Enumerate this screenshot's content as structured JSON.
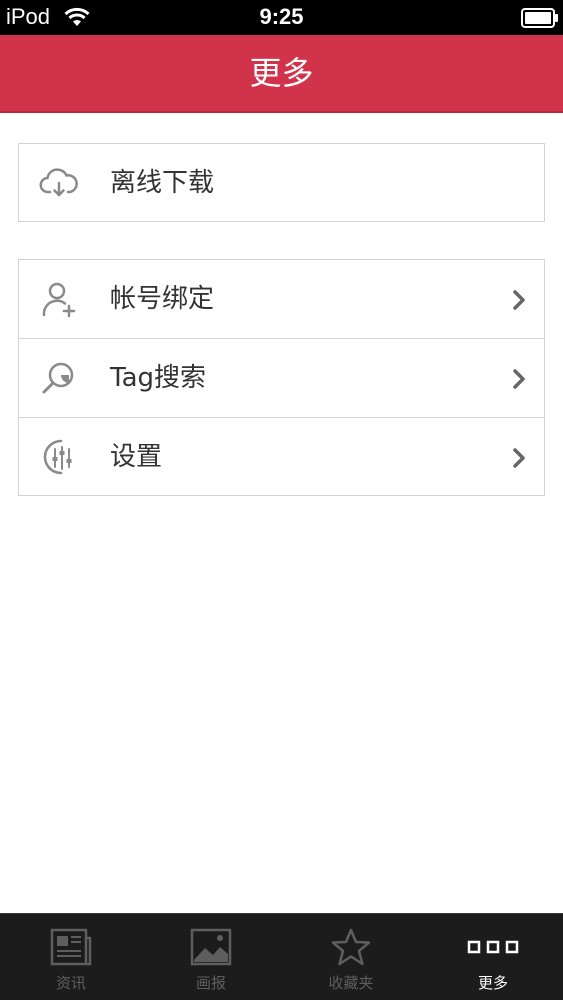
{
  "status_bar": {
    "carrier": "iPod",
    "time": "9:25"
  },
  "nav": {
    "title": "更多"
  },
  "groups": [
    {
      "items": [
        {
          "label": "离线下载",
          "icon": "cloud-download-icon",
          "has_chevron": false
        }
      ]
    },
    {
      "items": [
        {
          "label": "帐号绑定",
          "icon": "add-user-icon",
          "has_chevron": true
        },
        {
          "label": "Tag搜索",
          "icon": "tag-search-icon",
          "has_chevron": true
        },
        {
          "label": "设置",
          "icon": "settings-sliders-icon",
          "has_chevron": true
        }
      ]
    }
  ],
  "tab_bar": {
    "tabs": [
      {
        "label": "资讯",
        "icon": "newspaper-icon",
        "active": false
      },
      {
        "label": "画报",
        "icon": "picture-icon",
        "active": false
      },
      {
        "label": "收藏夹",
        "icon": "star-icon",
        "active": false
      },
      {
        "label": "更多",
        "icon": "more-dots-icon",
        "active": true
      }
    ]
  },
  "colors": {
    "nav_background": "#d0334a",
    "tab_bar_background": "#1c1c1c",
    "active_tab_text": "#ffffff",
    "inactive_tab_text": "#5e5e5e",
    "icon_gray": "#8a8a8a"
  }
}
